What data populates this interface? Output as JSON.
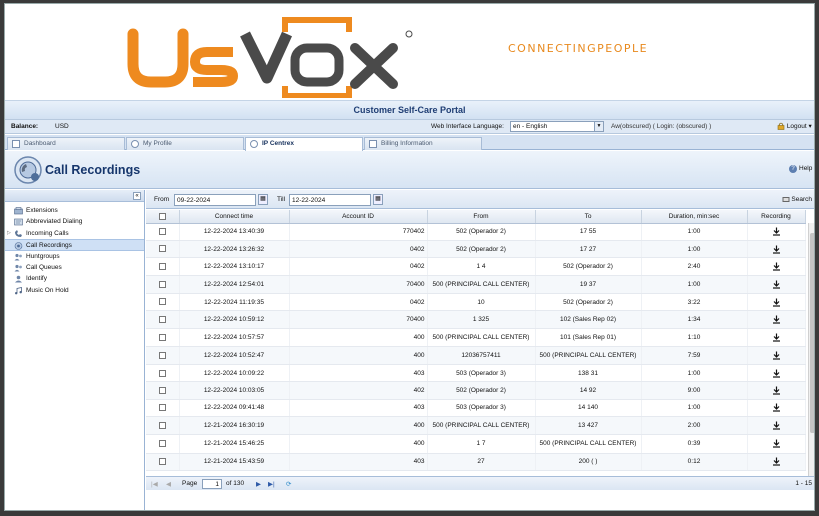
{
  "brand": {
    "logo_text": "UsVox",
    "tagline_part1": "CONNECTING",
    "tagline_part2": "PEOPLE",
    "orange": "#ee8a1f",
    "dark": "#4a4a4a"
  },
  "portal": {
    "title": "Customer Self-Care Portal"
  },
  "info": {
    "balance_label": "Balance:",
    "balance_value": "USD",
    "language_label": "Web Interface Language:",
    "language_value": "en - English",
    "user_text": "Aw(obscured) ( Login: (obscured) )",
    "logout_label": "Logout"
  },
  "tabs": [
    {
      "label": "Dashboard"
    },
    {
      "label": "My Profile"
    },
    {
      "label": "IP Centrex"
    },
    {
      "label": "Billing Information"
    }
  ],
  "page": {
    "title": "Call Recordings",
    "help_label": "Help"
  },
  "sidebar": {
    "items": [
      {
        "label": "Extensions"
      },
      {
        "label": "Abbreviated Dialing"
      },
      {
        "label": "Incoming Calls"
      },
      {
        "label": "Call Recordings"
      },
      {
        "label": "Huntgroups"
      },
      {
        "label": "Call Queues"
      },
      {
        "label": "Identify"
      },
      {
        "label": "Music On Hold"
      }
    ]
  },
  "filter": {
    "from_label": "From",
    "from_value": "09-22-2024",
    "till_label": "Till",
    "till_value": "12-22-2024",
    "search_label": "Search"
  },
  "grid": {
    "columns": [
      "Connect time",
      "Account ID",
      "From",
      "To",
      "Duration, min:sec",
      "Recording"
    ],
    "rows": [
      {
        "time": "12-22-2024 13:40:39",
        "account": "770402",
        "from": "502 (Operador 2)",
        "to": "17        55",
        "duration": "1:00"
      },
      {
        "time": "12-22-2024 13:26:32",
        "account": "0402",
        "from": "502 (Operador 2)",
        "to": "17        27",
        "duration": "1:00"
      },
      {
        "time": "12-22-2024 13:10:17",
        "account": "0402",
        "from": "1        4",
        "to": "502 (Operador 2)",
        "duration": "2:40"
      },
      {
        "time": "12-22-2024 12:54:01",
        "account": "70400",
        "from": "500 (PRINCIPAL CALL CENTER)",
        "to": "19        37",
        "duration": "1:00"
      },
      {
        "time": "12-22-2024 11:19:35",
        "account": "0402",
        "from": "        10",
        "to": "502 (Operador 2)",
        "duration": "3:22"
      },
      {
        "time": "12-22-2024 10:59:12",
        "account": "70400",
        "from": "1        325",
        "to": "102 (Sales Rep 02)",
        "duration": "1:34"
      },
      {
        "time": "12-22-2024 10:57:57",
        "account": "400",
        "from": "500 (PRINCIPAL CALL CENTER)",
        "to": "101 (Sales Rep 01)",
        "duration": "1:10"
      },
      {
        "time": "12-22-2024 10:52:47",
        "account": "400",
        "from": "12036757411",
        "to": "500 (PRINCIPAL CALL CENTER)",
        "duration": "7:59"
      },
      {
        "time": "12-22-2024 10:09:22",
        "account": "403",
        "from": "503 (Operador 3)",
        "to": "138        31",
        "duration": "1:00"
      },
      {
        "time": "12-22-2024 10:03:05",
        "account": "402",
        "from": "502 (Operador 2)",
        "to": "14        92",
        "duration": "9:00"
      },
      {
        "time": "12-22-2024 09:41:48",
        "account": "403",
        "from": "503 (Operador 3)",
        "to": "14        140",
        "duration": "1:00"
      },
      {
        "time": "12-21-2024 16:30:19",
        "account": "400",
        "from": "500 (PRINCIPAL CALL CENTER)",
        "to": "13        427",
        "duration": "2:00"
      },
      {
        "time": "12-21-2024 15:46:25",
        "account": "400",
        "from": "1        7",
        "to": "500 (PRINCIPAL CALL CENTER)",
        "duration": "0:39"
      },
      {
        "time": "12-21-2024 15:43:59",
        "account": "403",
        "from": "        27",
        "to": "200 (        )",
        "duration": "0:12"
      }
    ]
  },
  "pager": {
    "page_label": "Page",
    "page_value": "1",
    "of_label": "of 130",
    "range_label": "1 - 15"
  }
}
